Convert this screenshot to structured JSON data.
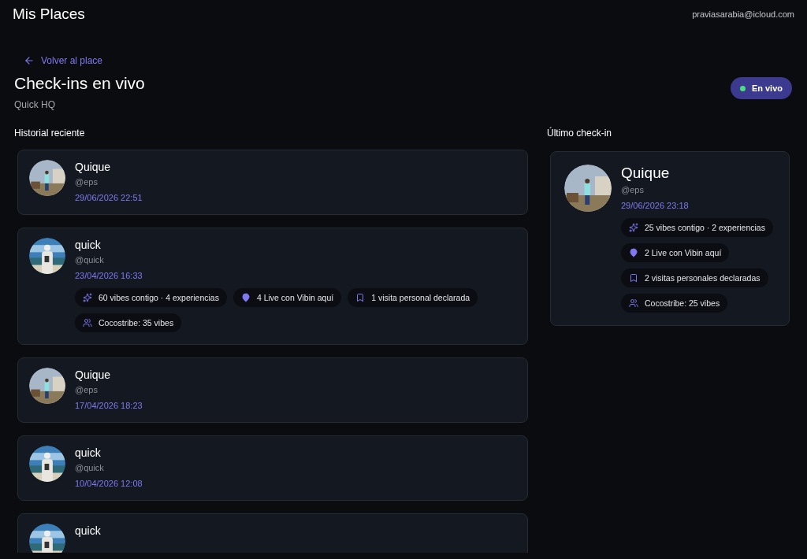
{
  "app_bar": {
    "title": "Mis Places",
    "user_email": "praviasarabia@icloud.com"
  },
  "back_link": "Volver al place",
  "page": {
    "title": "Check-ins en vivo",
    "subtitle": "Quick HQ",
    "live_badge": {
      "label": "En vivo",
      "on": true
    }
  },
  "history": {
    "heading": "Historial reciente",
    "items": [
      {
        "name": "Quique",
        "handle": "@eps",
        "time": "29/06/2026 22:51"
      },
      {
        "name": "quick",
        "handle": "@quick",
        "time": "23/04/2026 16:33",
        "stats": [
          {
            "kind": "vibes",
            "text": "60 vibes contigo · 4 experiencias"
          },
          {
            "kind": "live",
            "text": "4 Live con Vibin aquí"
          },
          {
            "kind": "visits",
            "text": "1 visita personal declarada"
          },
          {
            "kind": "tribe",
            "text": "Cocostribe: 35 vibes"
          }
        ]
      },
      {
        "name": "Quique",
        "handle": "@eps",
        "time": "17/04/2026 18:23"
      },
      {
        "name": "quick",
        "handle": "@quick",
        "time": "10/04/2026 12:08"
      },
      {
        "name": "quick"
      }
    ]
  },
  "latest": {
    "heading": "Último check-in",
    "name": "Quique",
    "handle": "@eps",
    "time": "29/06/2026 23:18",
    "stats": [
      {
        "kind": "vibes",
        "text": "25 vibes contigo · 2 experiencias"
      },
      {
        "kind": "live",
        "text": "2 Live con Vibin aquí"
      },
      {
        "kind": "visits",
        "text": "2 visitas personales declaradas"
      },
      {
        "kind": "tribe",
        "text": "Cocostribe: 25 vibes"
      }
    ]
  }
}
